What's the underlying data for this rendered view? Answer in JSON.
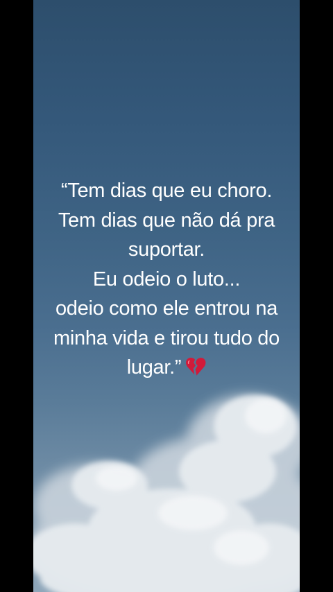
{
  "video": {
    "caption_lines": [
      "“Tem dias que eu choro.",
      "Tem dias que não dá pra",
      "suportar.",
      "Eu odeio o luto...",
      "odeio como ele entrou na",
      "minha vida e tirou tudo do",
      "lugar.”"
    ],
    "emoji": "broken-heart-icon",
    "colors": {
      "sky_top": "#2d4e6c",
      "sky_bottom": "#8ea6b9",
      "text": "#ffffff",
      "heart": "#d11a3a",
      "bars": "#000000"
    }
  }
}
